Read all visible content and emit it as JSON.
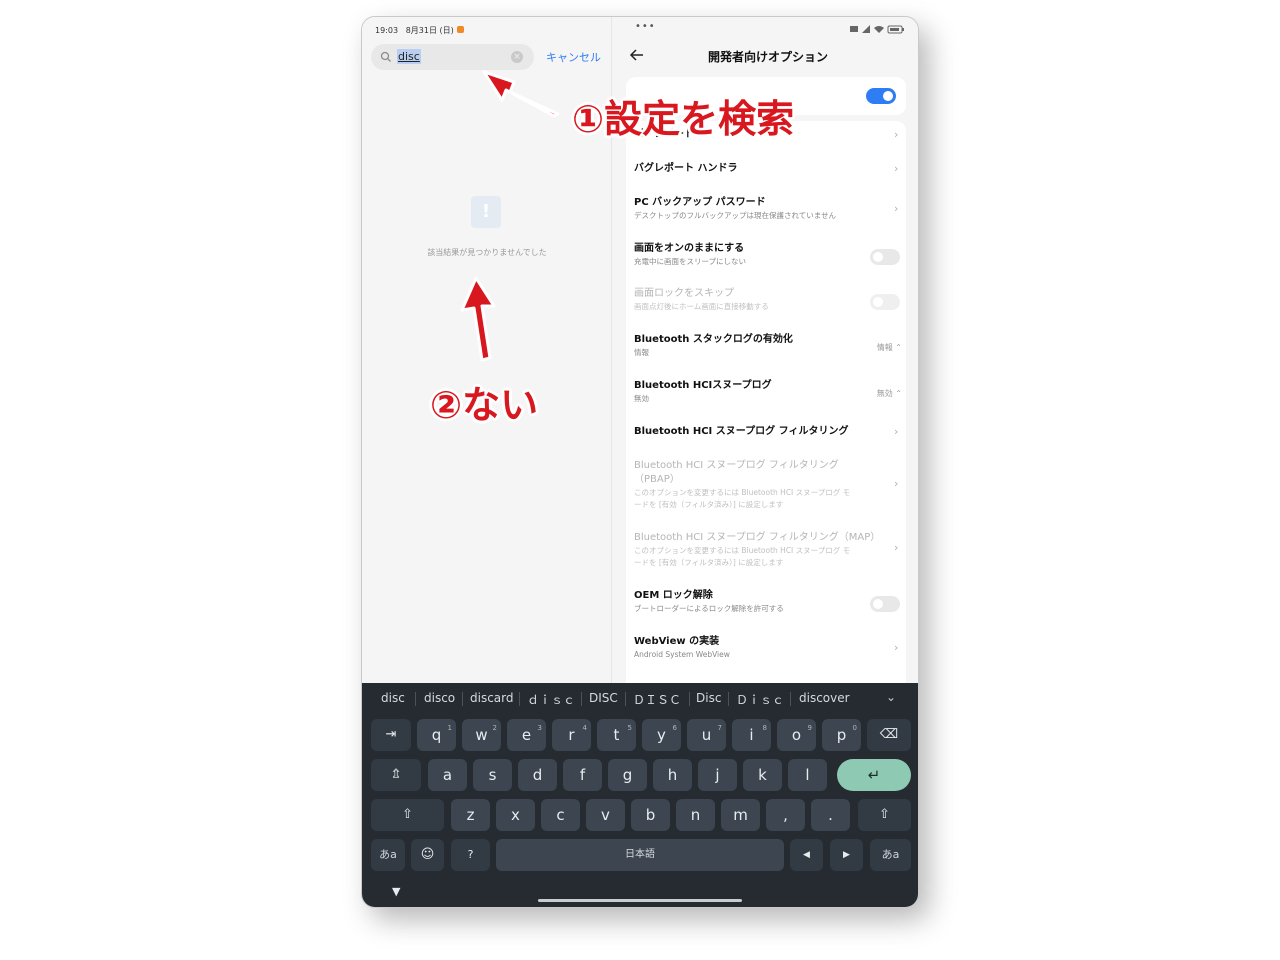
{
  "status_bar": {
    "time": "19:03",
    "date": "8月31日 (日)"
  },
  "search": {
    "query": "disc",
    "cancel_label": "キャンセル"
  },
  "empty_state": {
    "message": "該当結果が見つかりませんでした"
  },
  "settings": {
    "title": "開発者向けオプション",
    "main_toggle_on": true,
    "items": [
      {
        "title": "バグレポート",
        "subtitle": "",
        "control": "chevron",
        "enabled": true
      },
      {
        "title": "バグレポート ハンドラ",
        "subtitle": "",
        "control": "chevron",
        "enabled": true
      },
      {
        "title": "PC バックアップ パスワード",
        "subtitle": "デスクトップのフルバックアップは現在保護されていません",
        "control": "chevron",
        "enabled": true
      },
      {
        "title": "画面をオンのままにする",
        "subtitle": "充電中に画面をスリープにしない",
        "control": "switch",
        "state": false,
        "enabled": true
      },
      {
        "title": "画面ロックをスキップ",
        "subtitle": "画面点灯後にホーム画面に直接移動する",
        "control": "switch",
        "state": false,
        "enabled": false
      },
      {
        "title": "Bluetooth スタックログの有効化",
        "subtitle": "情報",
        "control": "select",
        "value": "情報",
        "enabled": true
      },
      {
        "title": "Bluetooth HCIスヌープログ",
        "subtitle": "無効",
        "control": "select",
        "value": "無効",
        "enabled": true
      },
      {
        "title": "Bluetooth HCI スヌープログ フィルタリング",
        "subtitle": "",
        "control": "chevron",
        "enabled": true
      },
      {
        "title": "Bluetooth HCI スヌープログ フィルタリング",
        "title2": "（PBAP）",
        "subtitle": "このオプションを変更するには Bluetooth HCI スヌープログ モ",
        "subtitle2": "ードを [有効（フィルタ済み）] に設定します",
        "control": "chevron",
        "enabled": false
      },
      {
        "title": "Bluetooth HCI スヌープログ フィルタリング（MAP）",
        "subtitle": "このオプションを変更するには Bluetooth HCI スヌープログ モ",
        "subtitle2": "ードを [有効（フィルタ済み）] に設定します",
        "control": "chevron",
        "enabled": false
      },
      {
        "title": "OEM ロック解除",
        "subtitle": "ブートローダーによるロック解除を許可する",
        "control": "switch",
        "state": false,
        "enabled": true
      },
      {
        "title": "WebView の実装",
        "subtitle": "Android System WebView",
        "control": "chevron",
        "enabled": true
      }
    ]
  },
  "keyboard": {
    "suggestions": [
      "disc",
      "disco",
      "discard",
      "ｄｉｓｃ",
      "DISC",
      "ＤＩＳＣ",
      "Disc",
      "Ｄｉｓｃ",
      "discover"
    ],
    "row1": [
      "q",
      "w",
      "e",
      "r",
      "t",
      "y",
      "u",
      "i",
      "o",
      "p"
    ],
    "row1_sup": [
      "1",
      "2",
      "3",
      "4",
      "5",
      "6",
      "7",
      "8",
      "9",
      "0"
    ],
    "row2": [
      "a",
      "s",
      "d",
      "f",
      "g",
      "h",
      "j",
      "k",
      "l"
    ],
    "row3": [
      "z",
      "x",
      "c",
      "v",
      "b",
      "n",
      "m",
      ",",
      "."
    ],
    "space_label": "日本語",
    "lang_label": "あa",
    "symbol_label": "?"
  },
  "annotations": {
    "step1": "①設定を検索",
    "step2": "②ない",
    "color": "#d8171f"
  }
}
